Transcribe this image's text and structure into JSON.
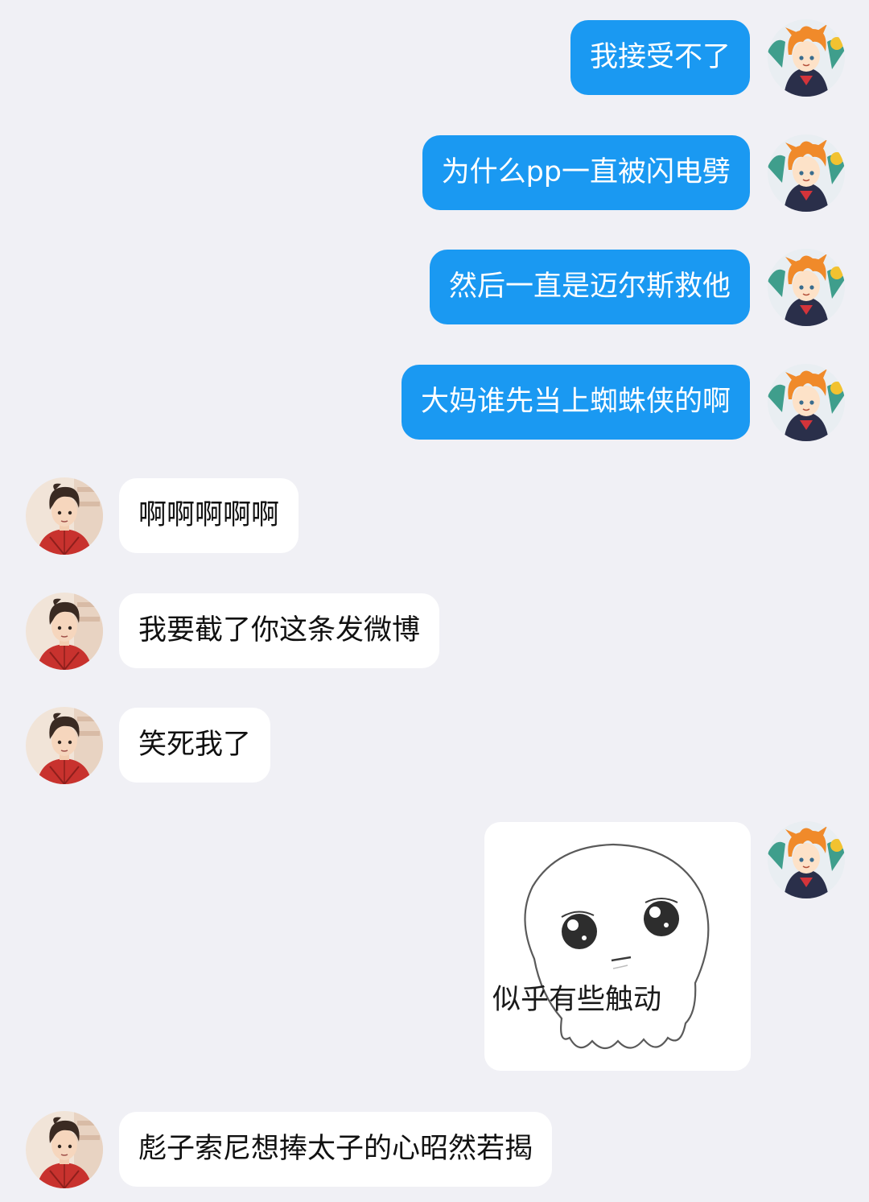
{
  "colors": {
    "background": "#f0f0f5",
    "outgoing_bubble": "#1a99f2",
    "incoming_bubble": "#ffffff"
  },
  "messages": [
    {
      "sender": "me",
      "kind": "text",
      "text": "我接受不了"
    },
    {
      "sender": "me",
      "kind": "text",
      "text": "为什么pp一直被闪电劈"
    },
    {
      "sender": "me",
      "kind": "text",
      "text": "然后一直是迈尔斯救他"
    },
    {
      "sender": "me",
      "kind": "text",
      "text": "大妈谁先当上蜘蛛侠的啊"
    },
    {
      "sender": "other",
      "kind": "text",
      "text": "啊啊啊啊啊"
    },
    {
      "sender": "other",
      "kind": "text",
      "text": "我要截了你这条发微博"
    },
    {
      "sender": "other",
      "kind": "text",
      "text": "笑死我了"
    },
    {
      "sender": "me",
      "kind": "sticker",
      "caption": "似乎有些触动",
      "icon": "ghost-sticker-icon"
    },
    {
      "sender": "other",
      "kind": "text",
      "text": "彪子索尼想捧太子的心昭然若揭"
    }
  ],
  "avatars": {
    "me": {
      "icon": "orange-haired-anime-boy-avatar"
    },
    "other": {
      "icon": "dark-haired-spiderman-suit-avatar"
    }
  }
}
